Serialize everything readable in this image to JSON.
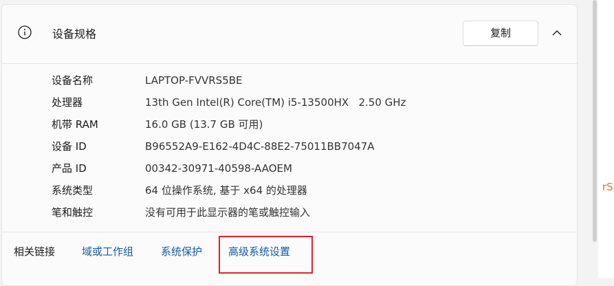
{
  "header": {
    "title": "设备规格",
    "copy_label": "复制"
  },
  "specs": [
    {
      "label": "设备名称",
      "value": "LAPTOP-FVVRS5BE"
    },
    {
      "label": "处理器",
      "value": "13th Gen Intel(R) Core(TM) i5-13500HX   2.50 GHz"
    },
    {
      "label": "机带 RAM",
      "value": "16.0 GB (13.7 GB 可用)"
    },
    {
      "label": "设备 ID",
      "value": "B96552A9-E162-4D4C-88E2-75011BB7047A"
    },
    {
      "label": "产品 ID",
      "value": "00342-30971-40598-AAOEM"
    },
    {
      "label": "系统类型",
      "value": "64 位操作系统, 基于 x64 的处理器"
    },
    {
      "label": "笔和触控",
      "value": "没有可用于此显示器的笔或触控输入"
    }
  ],
  "related": {
    "label": "相关链接",
    "links": [
      "域或工作组",
      "系统保护",
      "高级系统设置"
    ]
  },
  "side_text": "rS",
  "icons": {
    "info": "info-icon",
    "collapse": "chevron-up-icon"
  },
  "colors": {
    "link": "#0f5aa8",
    "highlight": "#e0202b",
    "side_text": "#d97a2a"
  }
}
